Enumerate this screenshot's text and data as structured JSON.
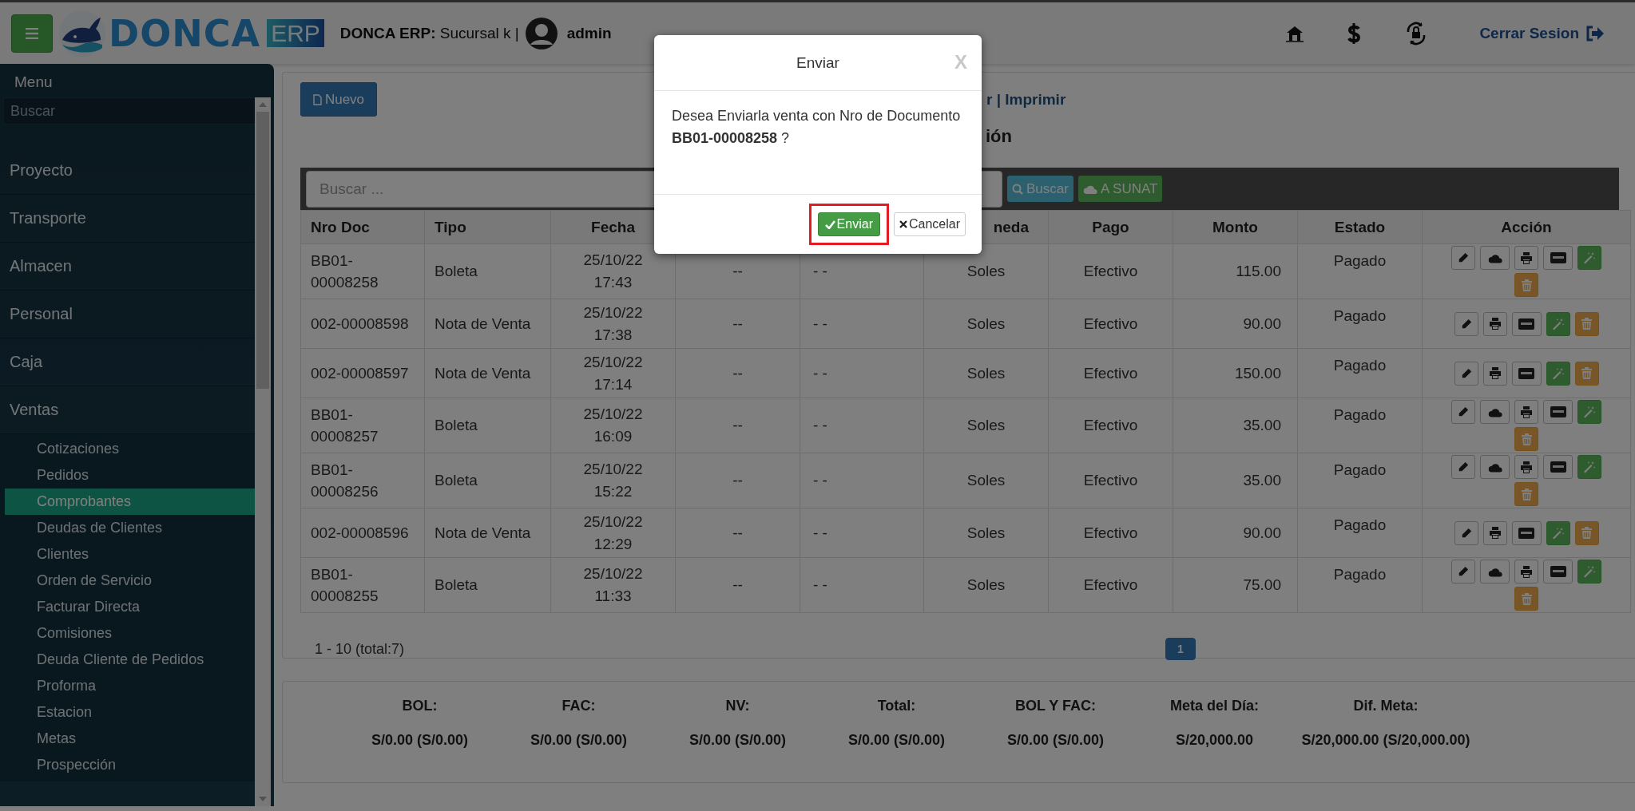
{
  "header": {
    "logo": {
      "text": "DONCA",
      "badge": "ERP"
    },
    "branch": "**DONCA ERP:** Sucursal k |",
    "user": "admin",
    "logout": "Cerrar Sesion"
  },
  "sidebar": {
    "title": "Menu",
    "search": {
      "placeholder": "Buscar"
    },
    "items": [
      {
        "label": "Proyecto",
        "selected": false
      },
      {
        "label": "Transporte",
        "selected": false
      },
      {
        "label": "Almacen",
        "selected": false
      },
      {
        "label": "Personal",
        "selected": false
      },
      {
        "label": "Caja",
        "selected": false
      },
      {
        "label": "Ventas",
        "selected": false,
        "children": [
          {
            "label": "Cotizaciones",
            "selected": false
          },
          {
            "label": "Pedidos",
            "selected": false
          },
          {
            "label": "Comprobantes",
            "selected": true
          },
          {
            "label": "Deudas de Clientes",
            "selected": false
          },
          {
            "label": "Clientes",
            "selected": false
          },
          {
            "label": "Orden de Servicio",
            "selected": false
          },
          {
            "label": "Facturar Directa",
            "selected": false
          },
          {
            "label": "Comisiones",
            "selected": false
          },
          {
            "label": "Deuda Cliente de Pedidos",
            "selected": false
          },
          {
            "label": "Proforma",
            "selected": false
          },
          {
            "label": "Estacion",
            "selected": false
          },
          {
            "label": "Metas",
            "selected": false
          },
          {
            "label": "Prospección",
            "selected": false
          }
        ]
      }
    ]
  },
  "main": {
    "new_button": "Nuevo",
    "links": "r | Imprimir",
    "heading": "ión"
  },
  "table": {
    "search": {
      "placeholder": "Buscar ..."
    },
    "buttons": [
      {
        "kind": "search",
        "label": "Buscar"
      },
      {
        "kind": "upload",
        "label": "A SUNAT"
      }
    ],
    "columns": [
      {
        "label": "Nro Doc"
      },
      {
        "label": "Tipo"
      },
      {
        "label": "Fecha"
      },
      {},
      {},
      {
        "label": "neda"
      },
      {
        "label": "Pago"
      },
      {
        "label": "Monto"
      },
      {
        "label": "Estado"
      },
      {
        "label": "Acción"
      }
    ],
    "rows": [
      {
        "nro_doc": "BB01-00008258",
        "tipo": "Boleta",
        "fecha": "25/10/22 17:43",
        "column_4": "--",
        "column_5": "- -",
        "moneda": "Soles",
        "pago": "Efectivo",
        "monto": "115.00",
        "estado": "Pagado",
        "cloud": true
      },
      {
        "nro_doc": "002-00008598",
        "tipo": "Nota de Venta",
        "fecha": "25/10/22 17:38",
        "column_4": "--",
        "column_5": "- -",
        "moneda": "Soles",
        "pago": "Efectivo",
        "monto": "90.00",
        "estado": "Pagado",
        "cloud": false
      },
      {
        "nro_doc": "002-00008597",
        "tipo": "Nota de Venta",
        "fecha": "25/10/22 17:14",
        "column_4": "--",
        "column_5": "- -",
        "moneda": "Soles",
        "pago": "Efectivo",
        "monto": "150.00",
        "estado": "Pagado",
        "cloud": false
      },
      {
        "nro_doc": "BB01-00008257",
        "tipo": "Boleta",
        "fecha": "25/10/22 16:09",
        "column_4": "--",
        "column_5": "- -",
        "moneda": "Soles",
        "pago": "Efectivo",
        "monto": "35.00",
        "estado": "Pagado",
        "cloud": true
      },
      {
        "nro_doc": "BB01-00008256",
        "tipo": "Boleta",
        "fecha": "25/10/22 15:22",
        "column_4": "--",
        "column_5": "- -",
        "moneda": "Soles",
        "pago": "Efectivo",
        "monto": "35.00",
        "estado": "Pagado",
        "cloud": true
      },
      {
        "nro_doc": "002-00008596",
        "tipo": "Nota de Venta",
        "fecha": "25/10/22 12:29",
        "column_4": "--",
        "column_5": "- -",
        "moneda": "Soles",
        "pago": "Efectivo",
        "monto": "90.00",
        "estado": "Pagado",
        "cloud": false
      },
      {
        "nro_doc": "BB01-00008255",
        "tipo": "Boleta",
        "fecha": "25/10/22 11:33",
        "column_4": "--",
        "column_5": "- -",
        "moneda": "Soles",
        "pago": "Efectivo",
        "monto": "75.00",
        "estado": "Pagado",
        "cloud": true
      }
    ],
    "pagination": {
      "summary": "1 - 10 (total:7)",
      "pages": [
        {
          "label": "1",
          "selected": true
        }
      ]
    }
  },
  "summary": [
    {
      "label": "BOL:",
      "value": "S/0.00 (S/0.00)"
    },
    {
      "label": "FAC:",
      "value": "S/0.00 (S/0.00)"
    },
    {
      "label": "NV:",
      "value": "S/0.00 (S/0.00)"
    },
    {
      "label": "Total:",
      "value": "S/0.00 (S/0.00)"
    },
    {
      "label": "BOL Y FAC:",
      "value": "S/0.00 (S/0.00)"
    },
    {
      "label": "Meta del Día:",
      "value": "S/20,000.00"
    },
    {
      "label": "Dif. Meta:",
      "value": "S/20,000.00 (S/20,000.00)"
    }
  ],
  "modal": {
    "title": "Enviar",
    "close": "X",
    "message": "Desea Enviarla venta con Nro de Documento **BB01-00008258** ?",
    "buttons": [
      {
        "kind": "confirm",
        "label": "Enviar",
        "highlighted": true
      },
      {
        "kind": "cancel",
        "label": "Cancelar",
        "highlighted": false
      }
    ]
  }
}
